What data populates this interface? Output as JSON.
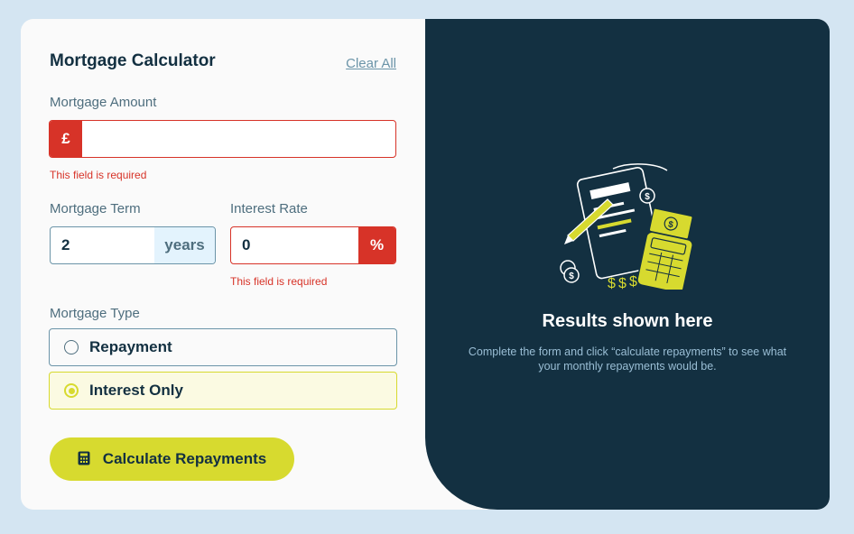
{
  "form": {
    "title": "Mortgage Calculator",
    "clear_all_label": "Clear All",
    "amount": {
      "label": "Mortgage Amount",
      "prefix": "£",
      "value": "",
      "error": "This field is required"
    },
    "term": {
      "label": "Mortgage Term",
      "value": "2",
      "suffix": "years"
    },
    "rate": {
      "label": "Interest Rate",
      "value": "0",
      "suffix": "%",
      "error": "This field is required"
    },
    "type": {
      "label": "Mortgage Type",
      "options": [
        {
          "label": "Repayment",
          "selected": false
        },
        {
          "label": "Interest Only",
          "selected": true
        }
      ]
    },
    "calculate_label": "Calculate Repayments",
    "calculate_icon": "calculator-icon"
  },
  "results": {
    "title": "Results shown here",
    "text": "Complete the form and click “calculate repayments” to see what your monthly repayments would be.",
    "illustration_icon": "empty-results-illustration"
  },
  "colors": {
    "background": "#d4e5f2",
    "accent_lime": "#d7da2f",
    "error_red": "#d73328",
    "dark_navy": "#133041",
    "slate": "#4e6e7e"
  }
}
